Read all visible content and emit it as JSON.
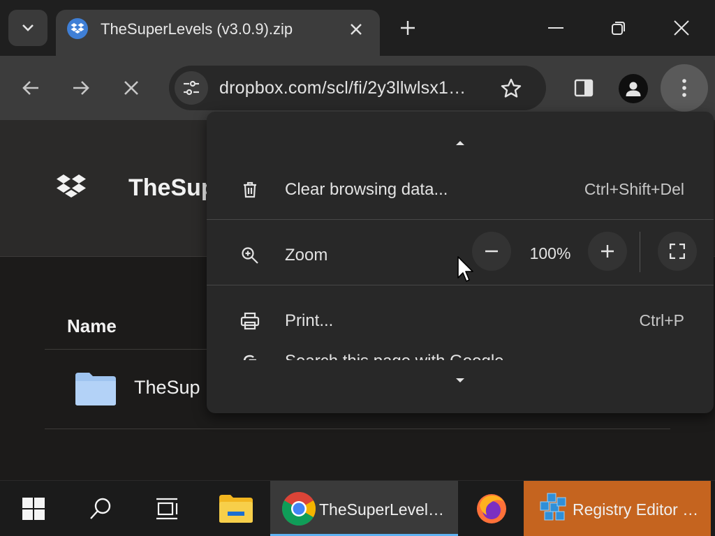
{
  "browser": {
    "tab": {
      "title": "TheSuperLevels (v3.0.9).zip",
      "favicon": "dropbox-icon"
    },
    "new_tab_label": "+",
    "window_controls": [
      "minimize-icon",
      "restore-icon",
      "close-icon"
    ],
    "toolbar": {
      "url": "dropbox.com/scl/fi/2y3llwlsx1…",
      "buttons": [
        "back-icon",
        "forward-icon",
        "stop-icon",
        "site-info-icon",
        "bookmark-star-icon",
        "side-panel-icon",
        "profile-icon",
        "more-menu-icon"
      ]
    }
  },
  "page": {
    "title": "TheSup",
    "column_header": "Name",
    "rows": [
      {
        "name": "TheSup",
        "icon": "folder-icon"
      }
    ]
  },
  "menu": {
    "clear_browsing": {
      "label": "Clear browsing data...",
      "shortcut": "Ctrl+Shift+Del",
      "icon": "trash-icon"
    },
    "zoom": {
      "label": "Zoom",
      "value": "100%",
      "minus": "−",
      "plus": "+",
      "icon": "zoom-icon"
    },
    "print": {
      "label": "Print...",
      "shortcut": "Ctrl+P",
      "icon": "print-icon"
    },
    "search_google": {
      "label": "Search this page with Google",
      "icon": "google-icon"
    }
  },
  "taskbar": {
    "apps": [
      {
        "label": "TheSuperLevel…",
        "icon": "chrome-icon"
      },
      {
        "label": "Registry Editor …",
        "icon": "registry-editor-icon"
      }
    ],
    "accent": "#5fb2f2",
    "registry_bg": "#c5641f"
  }
}
